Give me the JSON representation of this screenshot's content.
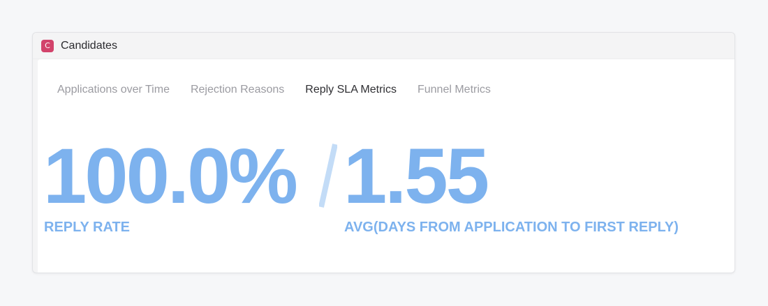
{
  "window": {
    "app_icon_letter": "C",
    "title": "Candidates"
  },
  "tabs": [
    {
      "label": "Applications over Time",
      "active": false
    },
    {
      "label": "Rejection Reasons",
      "active": false
    },
    {
      "label": "Reply SLA Metrics",
      "active": true
    },
    {
      "label": "Funnel Metrics",
      "active": false
    }
  ],
  "metrics": [
    {
      "value": "100.0%",
      "label": "REPLY RATE"
    },
    {
      "value": "1.55",
      "label": "AVG(DAYS FROM APPLICATION TO FIRST REPLY)"
    }
  ],
  "colors": {
    "accent": "#7db2ee",
    "separator": "#c3dcf7",
    "app_icon": "#d2436b"
  }
}
